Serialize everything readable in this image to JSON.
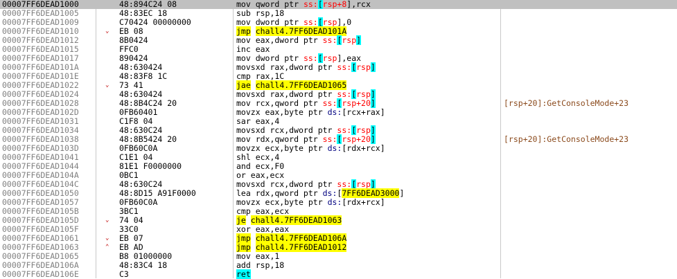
{
  "colors": {
    "selected_row": "#c0c0c0",
    "address": "#808080",
    "jump_arrow": "#c00000",
    "branch_highlight": "#ffff00",
    "stack_reg_highlight": "#00ffff",
    "segment": "#ff0000",
    "comment": "#8b4a1c"
  },
  "rows": [
    {
      "addr": "00007FF6DEAD1000",
      "mark": "",
      "bytes": "48:894C24 08",
      "selected": true,
      "instr": [
        {
          "t": "mov qword ptr "
        },
        {
          "t": "ss:",
          "c": "red"
        },
        {
          "t": "[",
          "h": "cyan"
        },
        {
          "t": "rsp+8",
          "c": "red"
        },
        {
          "t": "],rcx"
        }
      ],
      "comment": ""
    },
    {
      "addr": "00007FF6DEAD1005",
      "mark": "",
      "bytes": "48:83EC 18",
      "instr": [
        {
          "t": "sub rsp,18"
        }
      ],
      "comment": ""
    },
    {
      "addr": "00007FF6DEAD1009",
      "mark": "",
      "bytes": "C70424 00000000",
      "instr": [
        {
          "t": "mov dword ptr "
        },
        {
          "t": "ss:",
          "c": "red"
        },
        {
          "t": "[",
          "h": "cyan"
        },
        {
          "t": "rsp",
          "c": "red"
        },
        {
          "t": "],0"
        }
      ],
      "comment": ""
    },
    {
      "addr": "00007FF6DEAD1010",
      "mark": "⌄",
      "bytes": "EB 08",
      "instr": [
        {
          "t": "jmp",
          "h": "yellow"
        },
        {
          "t": " "
        },
        {
          "t": "chall4.7FF6DEAD101A",
          "h": "yellow"
        }
      ],
      "comment": ""
    },
    {
      "addr": "00007FF6DEAD1012",
      "mark": "",
      "bytes": "8B0424",
      "instr": [
        {
          "t": "mov eax,dword ptr "
        },
        {
          "t": "ss:",
          "c": "red"
        },
        {
          "t": "[",
          "h": "cyan"
        },
        {
          "t": "rsp",
          "c": "red"
        },
        {
          "t": "]",
          "h": "cyan"
        }
      ],
      "comment": ""
    },
    {
      "addr": "00007FF6DEAD1015",
      "mark": "",
      "bytes": "FFC0",
      "instr": [
        {
          "t": "inc eax"
        }
      ],
      "comment": ""
    },
    {
      "addr": "00007FF6DEAD1017",
      "mark": "",
      "bytes": "890424",
      "instr": [
        {
          "t": "mov dword ptr "
        },
        {
          "t": "ss:",
          "c": "red"
        },
        {
          "t": "[",
          "h": "cyan"
        },
        {
          "t": "rsp",
          "c": "red"
        },
        {
          "t": "],eax"
        }
      ],
      "comment": ""
    },
    {
      "addr": "00007FF6DEAD101A",
      "mark": "",
      "bytes": "48:630424",
      "instr": [
        {
          "t": "movsxd rax,dword ptr "
        },
        {
          "t": "ss:",
          "c": "red"
        },
        {
          "t": "[",
          "h": "cyan"
        },
        {
          "t": "rsp",
          "c": "red"
        },
        {
          "t": "]",
          "h": "cyan"
        }
      ],
      "comment": ""
    },
    {
      "addr": "00007FF6DEAD101E",
      "mark": "",
      "bytes": "48:83F8 1C",
      "instr": [
        {
          "t": "cmp rax,1C"
        }
      ],
      "comment": ""
    },
    {
      "addr": "00007FF6DEAD1022",
      "mark": "⌄",
      "bytes": "73 41",
      "instr": [
        {
          "t": "jae",
          "h": "yellow"
        },
        {
          "t": " "
        },
        {
          "t": "chall4.7FF6DEAD1065",
          "h": "yellow"
        }
      ],
      "comment": ""
    },
    {
      "addr": "00007FF6DEAD1024",
      "mark": "",
      "bytes": "48:630424",
      "instr": [
        {
          "t": "movsxd rax,dword ptr "
        },
        {
          "t": "ss:",
          "c": "red"
        },
        {
          "t": "[",
          "h": "cyan"
        },
        {
          "t": "rsp",
          "c": "red"
        },
        {
          "t": "]",
          "h": "cyan"
        }
      ],
      "comment": ""
    },
    {
      "addr": "00007FF6DEAD1028",
      "mark": "",
      "bytes": "48:8B4C24 20",
      "instr": [
        {
          "t": "mov rcx,qword ptr "
        },
        {
          "t": "ss:",
          "c": "red"
        },
        {
          "t": "[",
          "h": "cyan"
        },
        {
          "t": "rsp+20",
          "c": "red"
        },
        {
          "t": "]",
          "h": "cyan"
        }
      ],
      "comment": "[rsp+20]:GetConsoleMode+23"
    },
    {
      "addr": "00007FF6DEAD102D",
      "mark": "",
      "bytes": "0FB60401",
      "instr": [
        {
          "t": "movzx eax,byte ptr "
        },
        {
          "t": "ds:",
          "c": "blue"
        },
        {
          "t": "[rcx+rax]"
        }
      ],
      "comment": ""
    },
    {
      "addr": "00007FF6DEAD1031",
      "mark": "",
      "bytes": "C1F8 04",
      "instr": [
        {
          "t": "sar eax,4"
        }
      ],
      "comment": ""
    },
    {
      "addr": "00007FF6DEAD1034",
      "mark": "",
      "bytes": "48:630C24",
      "instr": [
        {
          "t": "movsxd rcx,dword ptr "
        },
        {
          "t": "ss:",
          "c": "red"
        },
        {
          "t": "[",
          "h": "cyan"
        },
        {
          "t": "rsp",
          "c": "red"
        },
        {
          "t": "]",
          "h": "cyan"
        }
      ],
      "comment": ""
    },
    {
      "addr": "00007FF6DEAD1038",
      "mark": "",
      "bytes": "48:8B5424 20",
      "instr": [
        {
          "t": "mov rdx,qword ptr "
        },
        {
          "t": "ss:",
          "c": "red"
        },
        {
          "t": "[",
          "h": "cyan"
        },
        {
          "t": "rsp+20",
          "c": "red"
        },
        {
          "t": "]",
          "h": "cyan"
        }
      ],
      "comment": "[rsp+20]:GetConsoleMode+23"
    },
    {
      "addr": "00007FF6DEAD103D",
      "mark": "",
      "bytes": "0FB60C0A",
      "instr": [
        {
          "t": "movzx ecx,byte ptr "
        },
        {
          "t": "ds:",
          "c": "blue"
        },
        {
          "t": "[rdx+rcx]"
        }
      ],
      "comment": ""
    },
    {
      "addr": "00007FF6DEAD1041",
      "mark": "",
      "bytes": "C1E1 04",
      "instr": [
        {
          "t": "shl ecx,4"
        }
      ],
      "comment": ""
    },
    {
      "addr": "00007FF6DEAD1044",
      "mark": "",
      "bytes": "81E1 F0000000",
      "instr": [
        {
          "t": "and ecx,F0"
        }
      ],
      "comment": ""
    },
    {
      "addr": "00007FF6DEAD104A",
      "mark": "",
      "bytes": "0BC1",
      "instr": [
        {
          "t": "or eax,ecx"
        }
      ],
      "comment": ""
    },
    {
      "addr": "00007FF6DEAD104C",
      "mark": "",
      "bytes": "48:630C24",
      "instr": [
        {
          "t": "movsxd rcx,dword ptr "
        },
        {
          "t": "ss:",
          "c": "red"
        },
        {
          "t": "[",
          "h": "cyan"
        },
        {
          "t": "rsp",
          "c": "red"
        },
        {
          "t": "]",
          "h": "cyan"
        }
      ],
      "comment": ""
    },
    {
      "addr": "00007FF6DEAD1050",
      "mark": "",
      "bytes": "48:8D15 A91F0000",
      "instr": [
        {
          "t": "lea rdx,qword ptr "
        },
        {
          "t": "ds:",
          "c": "blue"
        },
        {
          "t": "["
        },
        {
          "t": "7FF6DEAD3000",
          "h": "yellow"
        },
        {
          "t": "]"
        }
      ],
      "comment": ""
    },
    {
      "addr": "00007FF6DEAD1057",
      "mark": "",
      "bytes": "0FB60C0A",
      "instr": [
        {
          "t": "movzx ecx,byte ptr "
        },
        {
          "t": "ds:",
          "c": "blue"
        },
        {
          "t": "[rdx+rcx]"
        }
      ],
      "comment": ""
    },
    {
      "addr": "00007FF6DEAD105B",
      "mark": "",
      "bytes": "3BC1",
      "instr": [
        {
          "t": "cmp eax,ecx"
        }
      ],
      "comment": ""
    },
    {
      "addr": "00007FF6DEAD105D",
      "mark": "⌄",
      "bytes": "74 04",
      "instr": [
        {
          "t": "je",
          "h": "yellow"
        },
        {
          "t": " "
        },
        {
          "t": "chall4.7FF6DEAD1063",
          "h": "yellow"
        }
      ],
      "comment": ""
    },
    {
      "addr": "00007FF6DEAD105F",
      "mark": "",
      "bytes": "33C0",
      "instr": [
        {
          "t": "xor eax,eax"
        }
      ],
      "comment": ""
    },
    {
      "addr": "00007FF6DEAD1061",
      "mark": "⌄",
      "bytes": "EB 07",
      "instr": [
        {
          "t": "jmp",
          "h": "yellow"
        },
        {
          "t": " "
        },
        {
          "t": "chall4.7FF6DEAD106A",
          "h": "yellow"
        }
      ],
      "comment": ""
    },
    {
      "addr": "00007FF6DEAD1063",
      "mark": "⌃",
      "bytes": "EB AD",
      "instr": [
        {
          "t": "jmp",
          "h": "yellow"
        },
        {
          "t": " "
        },
        {
          "t": "chall4.7FF6DEAD1012",
          "h": "yellow"
        }
      ],
      "comment": ""
    },
    {
      "addr": "00007FF6DEAD1065",
      "mark": "",
      "bytes": "B8 01000000",
      "instr": [
        {
          "t": "mov eax,1"
        }
      ],
      "comment": ""
    },
    {
      "addr": "00007FF6DEAD106A",
      "mark": "",
      "bytes": "48:83C4 18",
      "instr": [
        {
          "t": "add rsp,18"
        }
      ],
      "comment": ""
    },
    {
      "addr": "00007FF6DEAD106E",
      "mark": "",
      "bytes": "C3",
      "instr": [
        {
          "t": "ret",
          "h": "cyan"
        }
      ],
      "comment": ""
    }
  ]
}
